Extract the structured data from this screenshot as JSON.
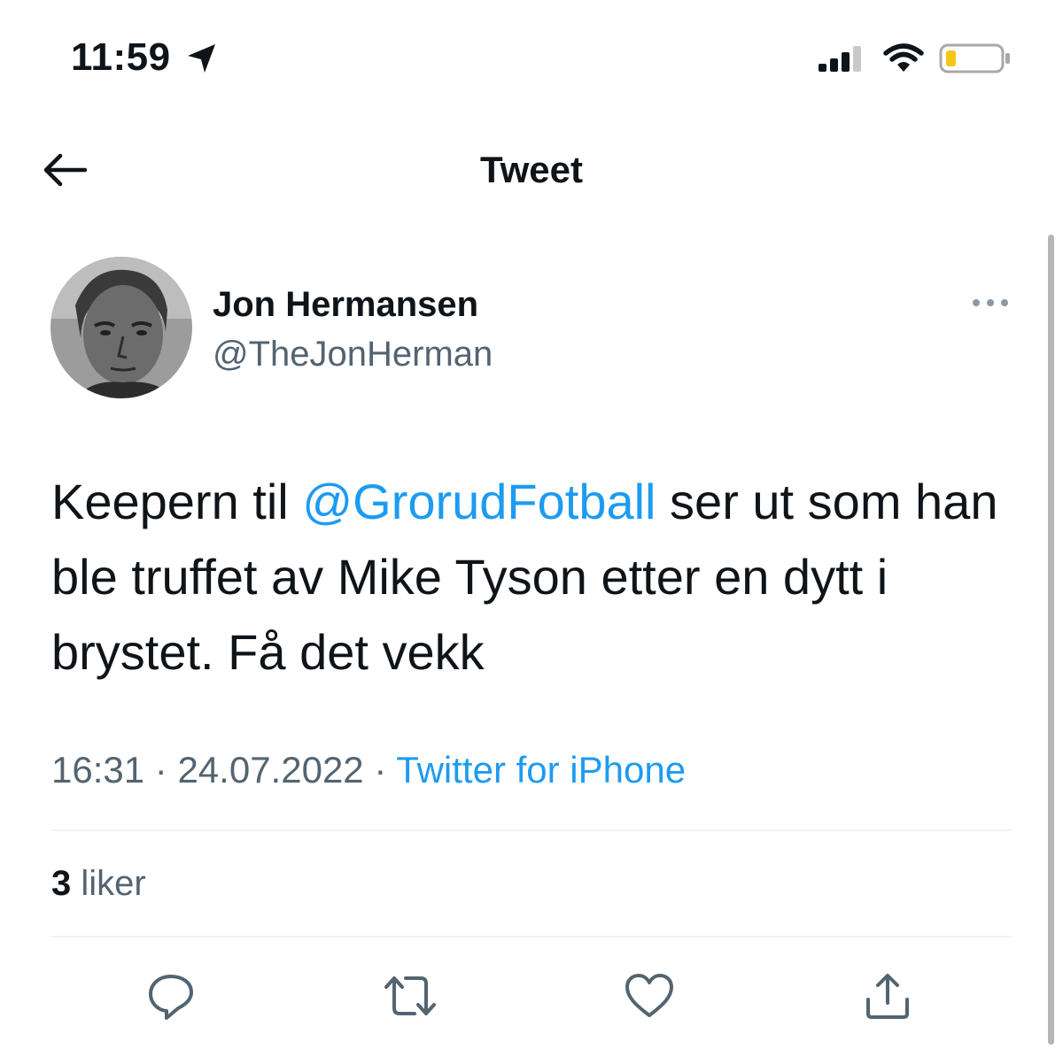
{
  "status_bar": {
    "time": "11:59",
    "icons": [
      "location-arrow-icon",
      "cellular-signal-icon",
      "wifi-icon",
      "battery-low-icon"
    ],
    "battery_color": "#f5c518"
  },
  "nav": {
    "back_icon": "arrow-left-icon",
    "title": "Tweet"
  },
  "tweet": {
    "author": {
      "name": "Jon Hermansen",
      "handle": "@TheJonHerman",
      "avatar": "avatar-photo"
    },
    "more_icon": "more-horizontal-icon",
    "text_before": "Keepern til ",
    "mention": "@GrorudFotball",
    "text_after": " ser ut som han ble truffet av Mike Tyson etter en dytt i brystet. Få det vekk",
    "time": "16:31",
    "date": "24.07.2022",
    "separator": "·",
    "source": "Twitter for iPhone",
    "likes_count": "3",
    "likes_label": "liker"
  },
  "actions": {
    "reply_icon": "reply-icon",
    "retweet_icon": "retweet-icon",
    "like_icon": "heart-icon",
    "share_icon": "share-icon"
  },
  "colors": {
    "text": "#0f1419",
    "secondary": "#536471",
    "accent": "#1d9bf0",
    "divider": "#eff3f4"
  }
}
